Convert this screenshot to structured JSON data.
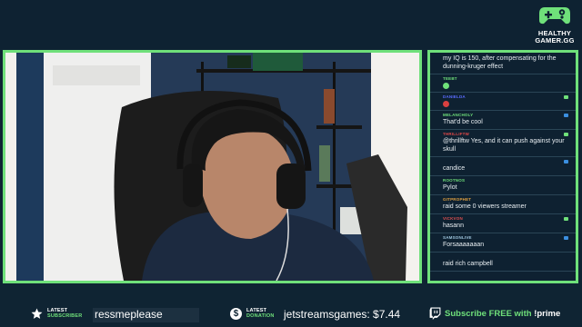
{
  "brand": {
    "line1": "HEALTHY",
    "line2": "GAMER.GG",
    "accent": "#6fe07a"
  },
  "chat": {
    "messages": [
      {
        "user": "",
        "text": "my IQ is 150, after compensating for the dunning-kruger effect",
        "user_color": "#ff7b7b",
        "badge_color": ""
      },
      {
        "user": "TEEBT",
        "text": "",
        "user_color": "#6fe07a",
        "badge_color": "",
        "emote": "green-emote"
      },
      {
        "user": "DANIELDA",
        "text": "",
        "user_color": "#5a6cff",
        "badge_color": "#6fe07a",
        "emote": "red-emote"
      },
      {
        "user": "MELANCHOLY",
        "text": "That'd be cool",
        "user_color": "#6fe07a",
        "badge_color": "#3b8fe0"
      },
      {
        "user": "THRILLIFTW",
        "text": "@thrillftw Yes, and it can push against your skull",
        "user_color": "#e04848",
        "badge_color": "#6fe07a"
      },
      {
        "user": "",
        "text": "candice",
        "user_color": "#5a8cff",
        "badge_color": "#3b8fe0"
      },
      {
        "user": "ROOTNOS",
        "text": "Pylot",
        "user_color": "#6fe07a",
        "badge_color": ""
      },
      {
        "user": "GITPROPHET",
        "text": "raid some 0 viewers streamer",
        "user_color": "#e0a040",
        "badge_color": ""
      },
      {
        "user": "VICKVON",
        "text": "hasann",
        "user_color": "#e05050",
        "badge_color": "#6fe07a"
      },
      {
        "user": "SAMSONLIVE",
        "text": "Forsaaaaaaan",
        "user_color": "#a0c8e0",
        "badge_color": "#3b8fe0"
      },
      {
        "user": "",
        "text": "raid rich campbell",
        "user_color": "#9b6cff",
        "badge_color": ""
      }
    ]
  },
  "alerts": {
    "subscriber": {
      "label_top": "LATEST",
      "label_bottom": "SUBSCRIBER",
      "name": "ressmeplease",
      "icon": "star-icon"
    },
    "donation": {
      "label_top": "LATEST",
      "label_bottom": "DONATION",
      "name": "jetstreamsgames: $7.44",
      "icon": "dollar-icon",
      "symbol": "$"
    },
    "twitch": {
      "cta": "Subscribe FREE with ",
      "prime": "!prime",
      "icon": "twitch-icon"
    }
  }
}
